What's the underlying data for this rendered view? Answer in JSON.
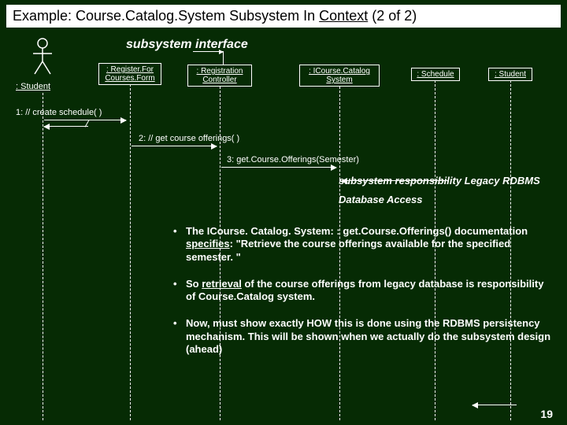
{
  "header": {
    "prefix": "Example: Course.Catalog.System Subsystem In ",
    "context": "Context",
    "suffix": "  (2 of 2)"
  },
  "labels": {
    "subsystem_interface": "subsystem interface",
    "actor": " : Student",
    "lifelines": {
      "lb1": " : Register.For Courses.Form",
      "lb2": " : Registration Controller",
      "lb3": " : ICourse.Catalog System",
      "lb4": " : Schedule",
      "lb5": " : Student"
    },
    "messages": {
      "m1": "1: // create schedule( )",
      "m2": "2: // get course offerings( )",
      "m3": "3: get.Course.Offerings(Semester)"
    },
    "resp": "subsystem responsibility Legacy RDBMS",
    "dbaccess": "Database Access"
  },
  "bullets": {
    "b1a": "The ICourse. Catalog. System: : get.Course.Offerings() documentation ",
    "b1b": "specifies",
    "b1c": ":  \"Retrieve the course offerings available for the specified semester. \"",
    "b2a": "So ",
    "b2b": "retrieval",
    "b2c": " of the course offerings from  legacy database is responsibility of  Course.Catalog system.",
    "b3": "Now, must show exactly HOW this is done using the RDBMS persistency mechanism. This will be shown when we actually do the subsystem design (ahead)"
  },
  "pagenum": "19"
}
